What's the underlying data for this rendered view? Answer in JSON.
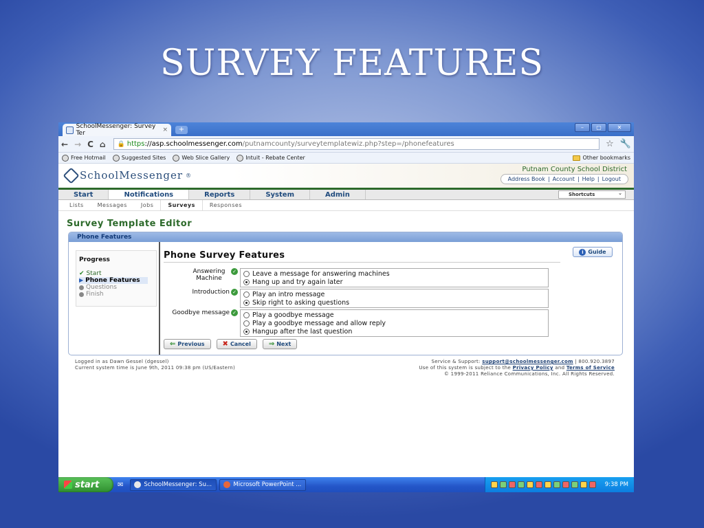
{
  "slide": {
    "title": "SURVEY FEATURES"
  },
  "browser": {
    "tab_title": "SchoolMessenger: Survey Ter",
    "tab_close": "×",
    "new_tab": "+",
    "win_min": "–",
    "win_max": "▢",
    "win_close": "✕",
    "back": "←",
    "forward": "→",
    "reload": "C",
    "home": "⌂",
    "url_scheme": "https",
    "url_sep": "://",
    "url_host": "asp.schoolmessenger.com",
    "url_path": "/putnamcounty/surveytemplatewiz.php?step=/phonefeatures",
    "bookmarks": [
      "Free Hotmail",
      "Suggested Sites",
      "Web Slice Gallery",
      "Intuit - Rebate Center"
    ],
    "other_bookmarks": "Other bookmarks"
  },
  "site": {
    "logo_text": "SchoolMessenger",
    "logo_mark": "®",
    "district": "Putnam County School District",
    "account_links": [
      "Address Book",
      "Account",
      "Help",
      "Logout"
    ],
    "sep": "|",
    "main_nav": [
      "Start",
      "Notifications",
      "Reports",
      "System",
      "Admin"
    ],
    "shortcuts": "Shortcuts",
    "sub_nav": [
      "Lists",
      "Messages",
      "Jobs",
      "Surveys",
      "Responses"
    ]
  },
  "editor": {
    "title": "Survey Template Editor",
    "panel_title": "Phone Features",
    "progress_title": "Progress",
    "steps": [
      "Start",
      "Phone Features",
      "Questions",
      "Finish"
    ],
    "form_title": "Phone Survey Features",
    "guide": "Guide",
    "rows": [
      {
        "label": "Answering Machine",
        "options": [
          "Leave a message for answering machines",
          "Hang up and try again later"
        ],
        "selected": 1
      },
      {
        "label": "Introduction",
        "options": [
          "Play an intro message",
          "Skip right to asking questions"
        ],
        "selected": 1
      },
      {
        "label": "Goodbye message",
        "options": [
          "Play a goodbye message",
          "Play a goodbye message and allow reply",
          "Hangup after the last question"
        ],
        "selected": 2
      }
    ],
    "buttons": {
      "previous": "Previous",
      "cancel": "Cancel",
      "next": "Next"
    }
  },
  "footer": {
    "logged_in": "Logged in as Dawn Gessel (dgessel)",
    "system_time": "Current system time is June 9th, 2011 09:38 pm (US/Eastern)",
    "support_prefix": "Service & Support:",
    "support_email": "support@schoolmessenger.com",
    "support_phone": "| 800.920.3897",
    "terms_prefix": "Use of this system is subject to the",
    "privacy": "Privacy Policy",
    "and": "and",
    "terms": "Terms of Service",
    "copyright": "© 1999-2011 Reliance Communications, Inc. All Rights Reserved."
  },
  "taskbar": {
    "start": "start",
    "tasks": [
      "SchoolMessenger: Su...",
      "Microsoft PowerPoint ..."
    ],
    "clock": "9:38 PM"
  }
}
